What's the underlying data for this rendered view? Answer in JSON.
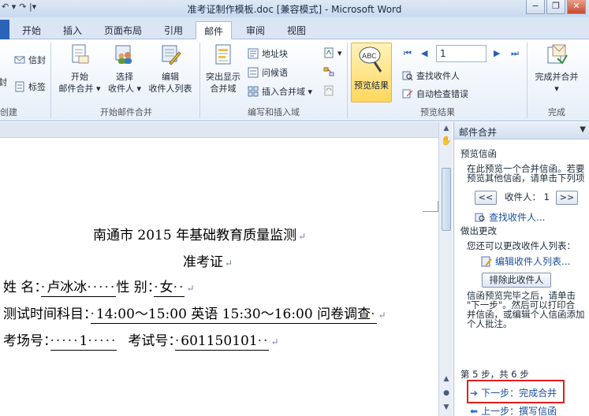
{
  "window": {
    "title": "准考证制作模板.doc [兼容模式] - Microsoft Word",
    "qat_icons": [
      "undo-icon",
      "redo-icon"
    ],
    "controls": [
      "minimize",
      "restore",
      "close"
    ]
  },
  "tabs": [
    "开始",
    "插入",
    "页面布局",
    "引用",
    "邮件",
    "审阅",
    "视图"
  ],
  "active_tab": "邮件",
  "ribbon": {
    "create": {
      "items": [
        "信封",
        "标签"
      ],
      "label": "创建",
      "left_partial": "封"
    },
    "start_merge": {
      "buttons": [
        {
          "line1": "开始",
          "line2": "邮件合并 ▾"
        },
        {
          "line1": "选择",
          "line2": "收件人 ▾"
        },
        {
          "line1": "编辑",
          "line2": "收件人列表"
        }
      ],
      "label": "开始邮件合并"
    },
    "write_insert": {
      "highlight_btn": {
        "line1": "突出显示",
        "line2": "合并域"
      },
      "items": [
        "地址块",
        "问候语",
        "插入合并域 ▾"
      ],
      "label": "编写和插入域"
    },
    "preview": {
      "preview_btn": "预览结果",
      "record_value": "1",
      "items": [
        "查找收件人",
        "自动检查错误"
      ],
      "label": "预览结果"
    },
    "finish": {
      "button": {
        "line1": "完成并合并",
        "line2": "▾"
      },
      "label": "完成"
    }
  },
  "document": {
    "heading1": "南通市 2015 年基础教育质量监测",
    "heading2": "准考证",
    "row1": {
      "label1": "姓  名：",
      "value1": "卢冰冰",
      "label2": "性  别：",
      "value2": "女"
    },
    "row2": {
      "label": "测试时间科目：",
      "value": "14:00～15:00  英语  15:30～16:00  问卷调查"
    },
    "row3": {
      "label1": "考场号：",
      "value1": "1",
      "label2": "考试号：",
      "value2": "601150101"
    },
    "para_mark": "↵"
  },
  "task_pane": {
    "title": "邮件合并",
    "preview_heading": "预览信函",
    "preview_desc1": "在此预览一个合并信函。若要",
    "preview_desc2": "预览其他信函，请单击下列项",
    "recipient_label": "收件人：",
    "recipient_num": "1",
    "prev_btn": "<<",
    "next_btn": ">>",
    "find_link": "查找收件人...",
    "changes_heading": "做出更改",
    "changes_desc": "您还可以更改收件人列表：",
    "edit_list_link": "编辑收件人列表...",
    "exclude_btn": "排除此收件人",
    "finish_desc1": "信函预览完毕之后，请单击",
    "finish_desc2": "\"下一步\"。然后可以打印合",
    "finish_desc3": "并信函，或编辑个人信函添加",
    "finish_desc4": "个人批注。",
    "step_text": "第 5 步，共 6 步",
    "next_step": "下一步：完成合并",
    "prev_step": "上一步：撰写信函"
  }
}
